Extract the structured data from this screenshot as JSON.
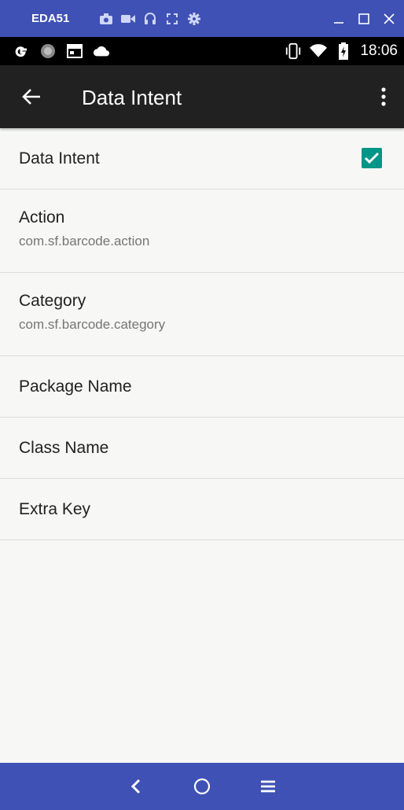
{
  "window": {
    "device_name": "EDA51",
    "tool_icons": [
      "camera-icon",
      "video-icon",
      "headphones-icon",
      "fullscreen-icon",
      "gear-icon"
    ],
    "controls": [
      "minimize-icon",
      "maximize-icon",
      "close-icon"
    ]
  },
  "status_bar": {
    "left_icons": [
      "google-icon",
      "circle-icon",
      "calendar-icon",
      "cloud-icon"
    ],
    "right_icons": [
      "vibrate-icon",
      "wifi-icon",
      "battery-charging-icon"
    ],
    "time": "18:06"
  },
  "app_bar": {
    "title": "Data Intent",
    "back_icon": "arrow-back-icon",
    "overflow_icon": "more-vert-icon"
  },
  "settings": [
    {
      "title": "Data Intent",
      "checked": true
    },
    {
      "title": "Action",
      "summary": "com.sf.barcode.action"
    },
    {
      "title": "Category",
      "summary": "com.sf.barcode.category"
    },
    {
      "title": "Package Name"
    },
    {
      "title": "Class Name"
    },
    {
      "title": "Extra Key"
    }
  ],
  "nav_bar": {
    "icons": [
      "nav-back-icon",
      "nav-home-icon",
      "nav-menu-icon"
    ]
  },
  "colors": {
    "window_bar": "#3f51b5",
    "app_bar": "#212121",
    "accent": "#009688",
    "background": "#f7f8f6"
  }
}
